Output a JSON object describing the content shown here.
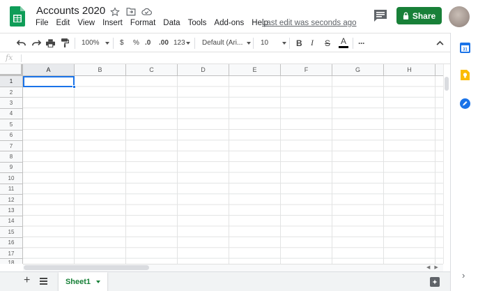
{
  "header": {
    "title": "Accounts 2020",
    "menu": [
      "File",
      "Edit",
      "View",
      "Insert",
      "Format",
      "Data",
      "Tools",
      "Add-ons",
      "Help"
    ],
    "last_edit": "Last edit was seconds ago",
    "share_label": "Share"
  },
  "toolbar": {
    "zoom": "100%",
    "currency": "$",
    "percent": "%",
    "decrease_decimal": ".0",
    "increase_decimal": ".00",
    "more_formats": "123",
    "font": "Default (Ari...",
    "font_size": "10",
    "bold": "B",
    "italic": "I",
    "strike": "S",
    "text_color": "A",
    "more": "···"
  },
  "formula_bar": {
    "fx_label": "fx",
    "value": ""
  },
  "grid": {
    "columns": [
      "A",
      "B",
      "C",
      "D",
      "E",
      "F",
      "G",
      "H"
    ],
    "rows": [
      "1",
      "2",
      "3",
      "4",
      "5",
      "6",
      "7",
      "8",
      "9",
      "10",
      "11",
      "12",
      "13",
      "14",
      "15",
      "16",
      "17",
      "18"
    ],
    "selected_cell": "A1"
  },
  "sheets": {
    "tabs": [
      {
        "label": "Sheet1",
        "active": true
      }
    ]
  },
  "colors": {
    "accent_green": "#188038",
    "selection_blue": "#1a73e8"
  },
  "icons": {
    "header": [
      "sheets-logo-icon",
      "star-icon",
      "move-folder-icon",
      "cloud-saved-icon",
      "comments-icon",
      "lock-icon"
    ],
    "toolbar": [
      "undo-icon",
      "redo-icon",
      "print-icon",
      "paint-format-icon"
    ],
    "side_panel": [
      "calendar-icon",
      "keep-icon",
      "tasks-icon",
      "chevron-right-icon"
    ]
  }
}
